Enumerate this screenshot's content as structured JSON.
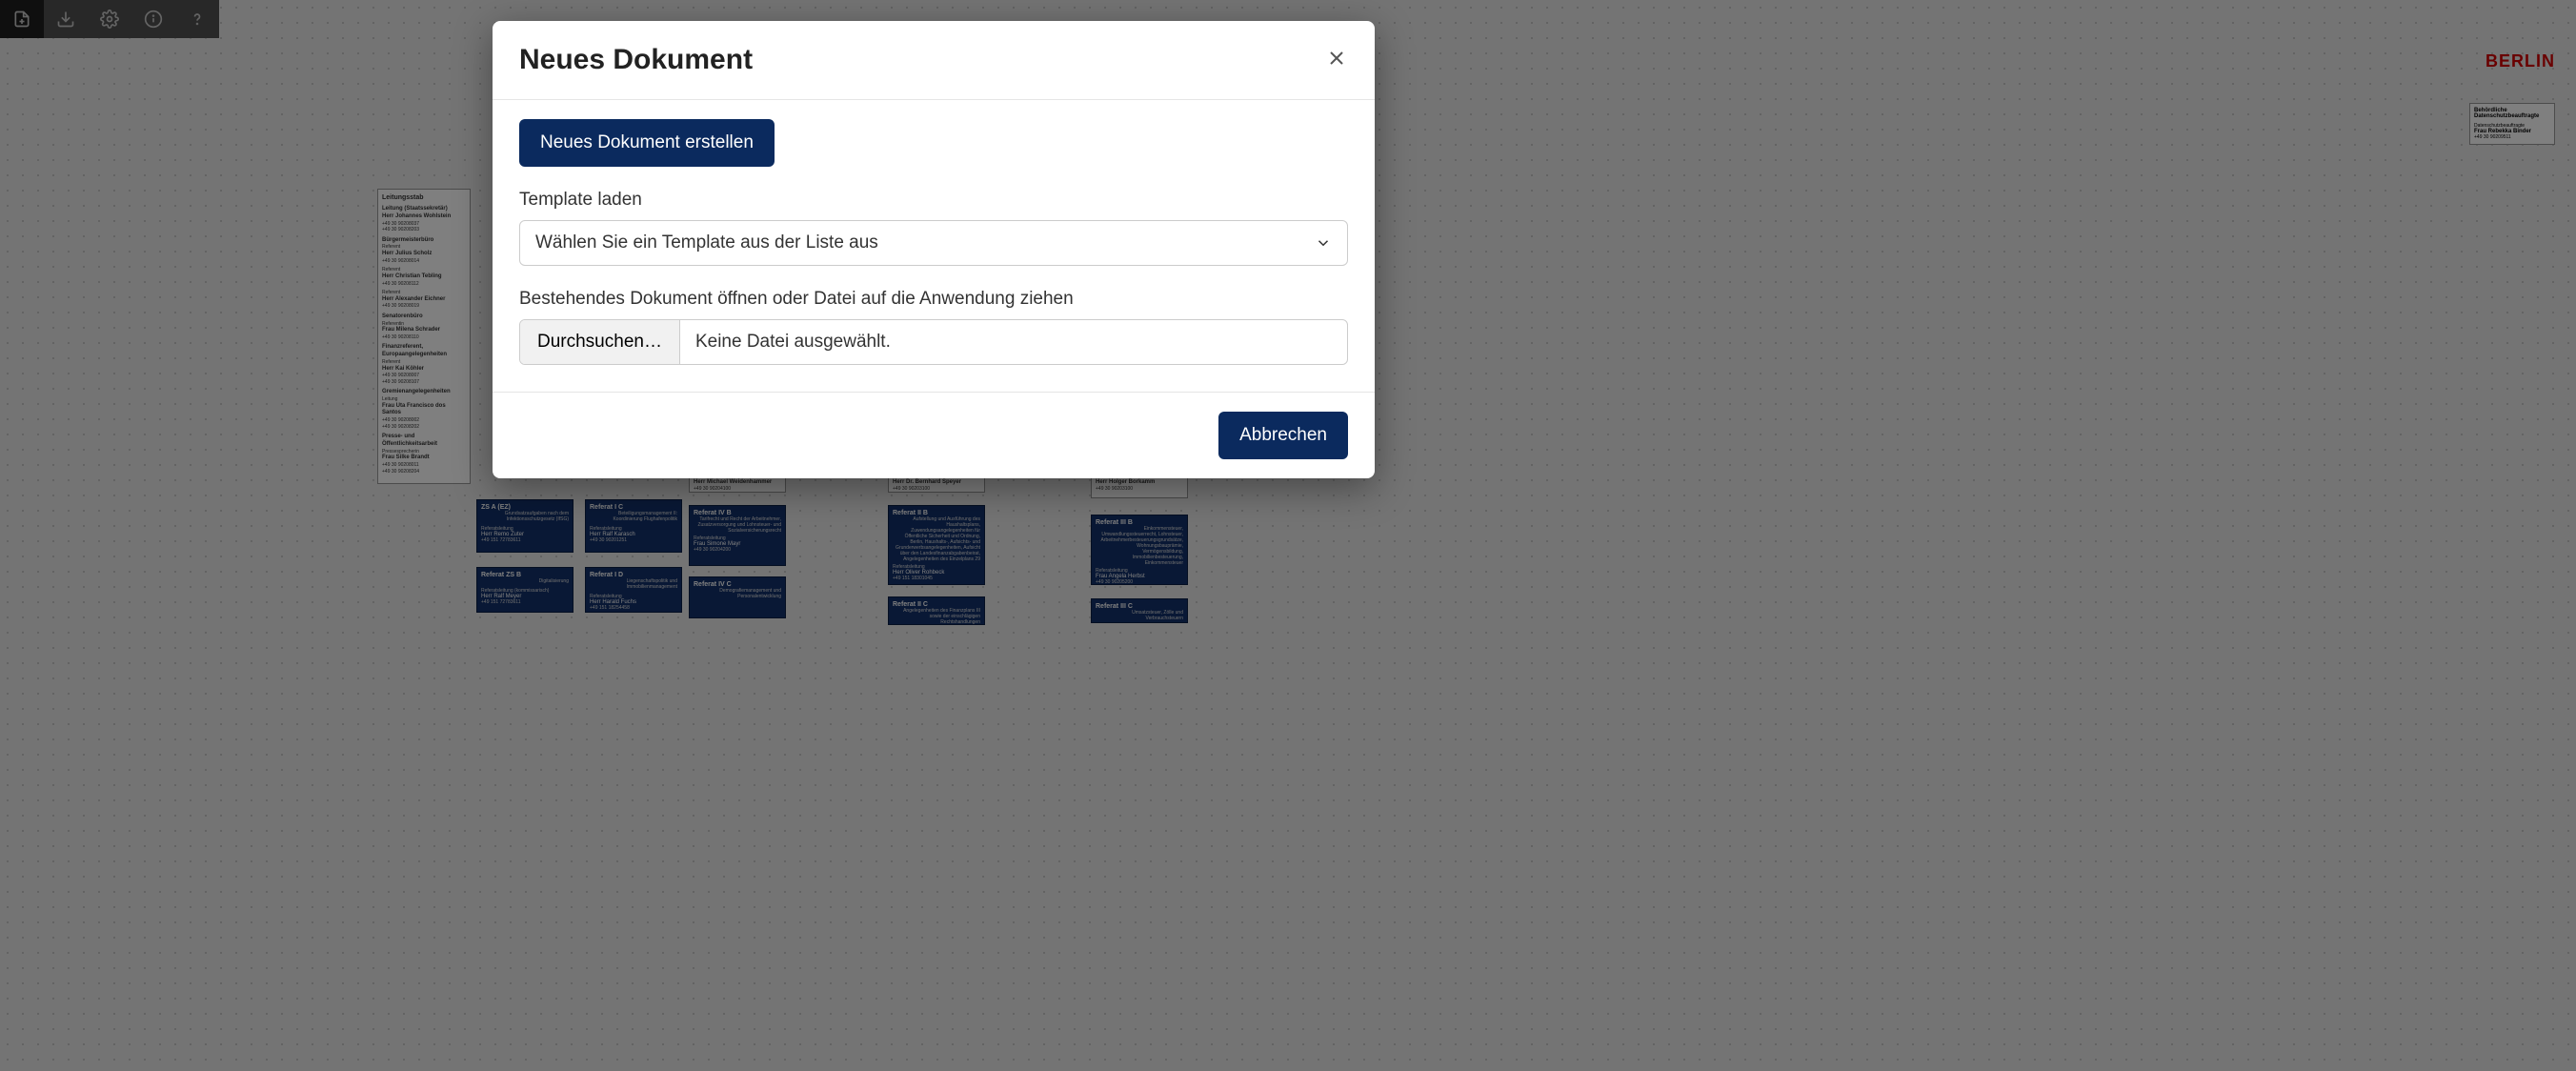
{
  "toolbar": {
    "new": "new-doc",
    "download": "download",
    "settings": "settings",
    "info": "info",
    "help": "help"
  },
  "modal": {
    "title": "Neues Dokument",
    "create_btn": "Neues Dokument erstellen",
    "template_label": "Template laden",
    "template_placeholder": "Wählen Sie ein Template aus der Liste aus",
    "open_label": "Bestehendes Dokument öffnen oder Datei auf die Anwendung ziehen",
    "browse_btn": "Durchsuchen…",
    "no_file": "Keine Datei ausgewählt.",
    "cancel_btn": "Abbrechen"
  },
  "brand": "BERLIN",
  "datenschutz": {
    "title": "Behördliche Datenschutzbeauftragte",
    "role": "Datenschutzbeauftragte",
    "name": "Frau Rebekka Binder",
    "phone": "+49 30 90209511"
  },
  "leitungsstab": {
    "title": "Leitungsstab",
    "sections": [
      {
        "role": "Leitung (Staatssekretär)",
        "name": "Herr Johannes Wohlstein",
        "phones": [
          "+49 30 90208037",
          "+49 30 90208203"
        ]
      },
      {
        "role": "Bürgermeisterbüro",
        "sub": "Referent",
        "name": "Herr Julius Scholz",
        "phone": "+49 30 90208014"
      },
      {
        "sub": "Referent",
        "name": "Herr Christian Tebling",
        "phone": "+49 30 90208112"
      },
      {
        "sub": "Referent",
        "name": "Herr Alexander Eichner",
        "phone": "+49 30 90208019"
      },
      {
        "role": "Senatorenbüro",
        "sub": "Referentin",
        "name": "Frau Milena Schrader",
        "phone": "+49 30 90208110"
      },
      {
        "role": "Finanzreferent, Europaangelegenheiten",
        "sub": "Referent",
        "name": "Herr Kai Köhler",
        "phones": [
          "+49 30 90208007",
          "+49 30 90208107"
        ]
      },
      {
        "role": "Gremienangelegenheiten",
        "sub": "Leitung",
        "name": "Frau Uta Francisco dos Santos",
        "phones": [
          "+49 30 90208002",
          "+49 30 90208202"
        ]
      },
      {
        "role": "Presse- und Öffentlichkeitsarbeit",
        "sub": "Pressesprecherin",
        "name": "Frau Silke Brandt",
        "phones": [
          "+49 30 90208011",
          "+49 30 90208204"
        ]
      }
    ]
  },
  "depts": [
    {
      "id": "zs-a-ez",
      "title": "ZS A (EZ)",
      "desc": "Grundsatzaufgaben nach dem Infektionsschutzgesetz (IfSG)",
      "lead_role": "Referatsleitung",
      "lead": "Herr Remo Zuter",
      "phone": "+49 151 72783611"
    },
    {
      "id": "zs-b",
      "title": "Referat ZS B",
      "desc": "Digitalisierung",
      "lead_role": "Referatsleitung (kommissarisch)",
      "lead": "Herr Ralf Meyer",
      "phone": "+49 151 72783611"
    },
    {
      "id": "i-c",
      "title": "Referat I C",
      "desc": "Beteiligungsmanagement II: Koordinierung Flughafenpolitik",
      "lead_role": "Referatsleitung",
      "lead": "Herr Ralf Karasch",
      "phone": "+49 30 90201251"
    },
    {
      "id": "i-d",
      "title": "Referat I D",
      "desc": "Liegenschaftspolitik und Immobilienmanagement",
      "lead_role": "Referatsleitung",
      "lead": "Herr Harald Fuchs",
      "phone": "+49 151 18254458"
    },
    {
      "id": "iv-a-ext",
      "title": "",
      "desc": "",
      "lead_role": "Referatsleitung",
      "lead": "Herr Michael Weidenhammer",
      "phone": "+49 30 90204100"
    },
    {
      "id": "iv-b",
      "title": "Referat IV B",
      "desc": "Tarifrecht und Recht der Arbeitnehmer, Zusatzversorgung und Lohnsteuer- und Sozialversicherungsrecht",
      "lead_role": "Referatsleitung",
      "lead": "Frau Simone Mayr",
      "phone": "+49 30 90204200"
    },
    {
      "id": "iv-c",
      "title": "Referat IV C",
      "desc": "Demografiemanagement und Personalentwicklung",
      "lead_role": "",
      "lead": "",
      "phone": ""
    },
    {
      "id": "ii-a-ext",
      "title": "",
      "desc": "",
      "lead_role": "Referatsleitung",
      "lead": "Herr Dr. Bernhard Speyer",
      "phone": "+49 30 90203100"
    },
    {
      "id": "ii-b",
      "title": "Referat II B",
      "desc": "Aufstellung und Ausführung des Haushaltsplans, Zuwendungsangelegenheiten für Öffentliche Sicherheit und Ordnung, Berlin, Haushalts-, Aufsichts- und Grunderwerbsangelegenheiten, Aufsicht über den Landesfinanzabgabenbeirat, Angelegenheiten des Einzelplans 29",
      "lead_role": "Referatsleitung",
      "lead": "Herr Oliver Rohbeck",
      "phone": "+49 151 18301045"
    },
    {
      "id": "ii-c",
      "title": "Referat II C",
      "desc": "Angelegenheiten des Finanzplans III sowie der einschlägigen Rechtshandlungen",
      "lead_role": "",
      "lead": "",
      "phone": ""
    },
    {
      "id": "iii-a-ext",
      "title": "",
      "desc": "",
      "lead_role": "Referatsleitung",
      "lead": "Herr Holger Borkamm",
      "phone": "+49 30 90203100"
    },
    {
      "id": "iii-b",
      "title": "Referat III B",
      "desc": "Einkommensteuer, Umwandlungssteuerrecht, Lohnsteuer, Arbeitnehmerbesteuerungsgrundsätze, Wohnungsbauprämie, Vermögensbildung, Immobilienbesteuerung, Einkommensteuer",
      "lead_role": "Referatsleitung",
      "lead": "Frau Angela Herbst",
      "phone": "+49 30 90205200"
    },
    {
      "id": "iii-c",
      "title": "Referat III C",
      "desc": "Umsatzsteuer, Zölle und Verbrauchsteuern",
      "lead_role": "",
      "lead": "",
      "phone": ""
    }
  ]
}
